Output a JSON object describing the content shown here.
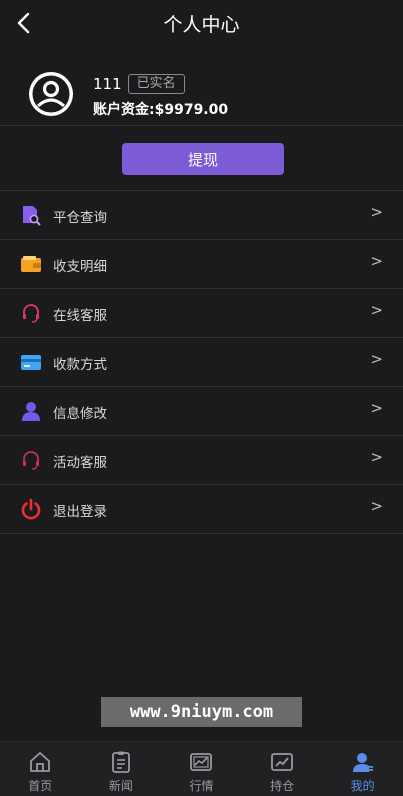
{
  "header": {
    "title": "个人中心"
  },
  "profile": {
    "user_id": "111",
    "verify_badge": "已实名",
    "balance": "账户资金:$9979.00"
  },
  "actions": {
    "withdraw_label": "提现"
  },
  "menu": {
    "items": [
      {
        "label": "平仓查询",
        "icon": "search-document-icon",
        "arrow": ">"
      },
      {
        "label": "收支明细",
        "icon": "wallet-icon",
        "arrow": ">"
      },
      {
        "label": "在线客服",
        "icon": "headset-icon",
        "arrow": ">"
      },
      {
        "label": "收款方式",
        "icon": "card-icon",
        "arrow": ">"
      },
      {
        "label": "信息修改",
        "icon": "user-icon",
        "arrow": ">"
      },
      {
        "label": "活动客服",
        "icon": "headset-icon",
        "arrow": ">"
      },
      {
        "label": "退出登录",
        "icon": "power-icon",
        "arrow": ">"
      }
    ]
  },
  "watermark": {
    "text": "www.9niuym.com"
  },
  "tabbar": {
    "tabs": [
      {
        "label": "首页",
        "icon": "home-icon"
      },
      {
        "label": "新闻",
        "icon": "clipboard-icon"
      },
      {
        "label": "行情",
        "icon": "chart-icon"
      },
      {
        "label": "持仓",
        "icon": "trend-icon"
      },
      {
        "label": "我的",
        "icon": "profile-icon",
        "active": true
      }
    ]
  },
  "colors": {
    "background": "#1b1b1d",
    "accent": "#7b5bd6",
    "tab_active": "#5b8de8"
  }
}
